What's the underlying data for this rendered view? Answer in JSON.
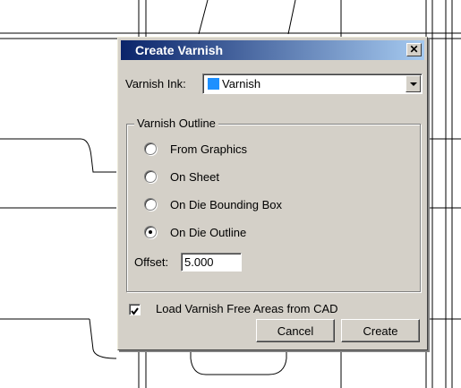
{
  "dialog": {
    "title": "Create Varnish",
    "close_glyph": "✕",
    "varnish_ink_label": "Varnish Ink:",
    "varnish_ink_value": "Varnish",
    "varnish_ink_color": "#1e90ff",
    "outline_group": {
      "legend": "Varnish Outline",
      "options": [
        {
          "label": "From Graphics",
          "selected": false
        },
        {
          "label": "On Sheet",
          "selected": false
        },
        {
          "label": "On Die Bounding Box",
          "selected": false
        },
        {
          "label": "On Die Outline",
          "selected": true
        }
      ],
      "offset_label": "Offset:",
      "offset_value": "5.000"
    },
    "load_free_areas": {
      "label": "Load Varnish Free Areas from CAD",
      "checked": true
    },
    "buttons": {
      "cancel": "Cancel",
      "create": "Create"
    }
  },
  "icons": {
    "close": "close-icon",
    "dropdown": "chevron-down-icon",
    "check": "check-icon"
  }
}
